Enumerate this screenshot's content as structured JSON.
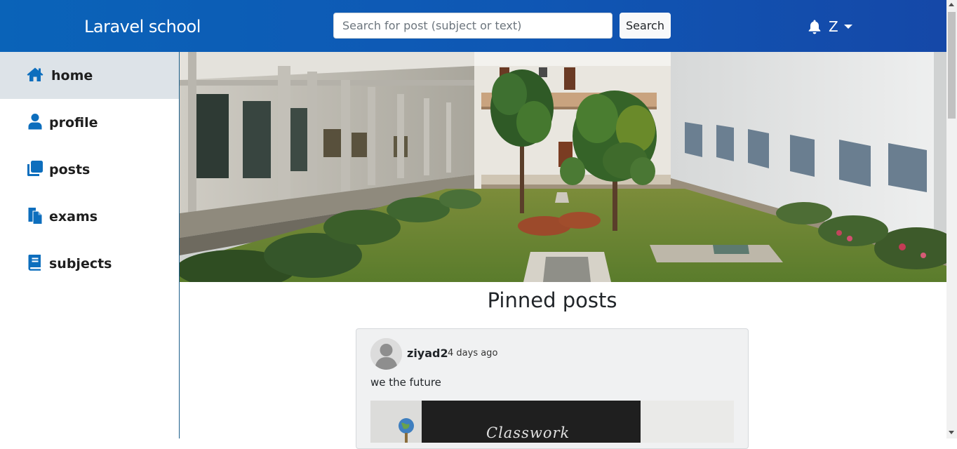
{
  "navbar": {
    "brand": "Laravel school",
    "search_placeholder": "Search for post (subject or text)",
    "search_button": "Search",
    "user_initial": "Z",
    "icons": {
      "notifications": "bell-icon",
      "dropdown": "caret-down-icon"
    }
  },
  "sidebar": {
    "items": [
      {
        "label": "home",
        "icon": "home-icon",
        "active": true
      },
      {
        "label": "profile",
        "icon": "user-icon",
        "active": false
      },
      {
        "label": "posts",
        "icon": "posts-icon",
        "active": false
      },
      {
        "label": "exams",
        "icon": "exams-icon",
        "active": false
      },
      {
        "label": "subjects",
        "icon": "book-icon",
        "active": false
      }
    ]
  },
  "main": {
    "section_title": "Pinned posts",
    "posts": [
      {
        "author": "ziyad2",
        "time": "4 days ago",
        "text": "we the future",
        "image_text": "Classwork"
      }
    ]
  },
  "colors": {
    "navbar_start": "#0a63b8",
    "navbar_end": "#1548a8",
    "accent": "#0d6ebd",
    "active_item_bg": "#dde3e8"
  }
}
